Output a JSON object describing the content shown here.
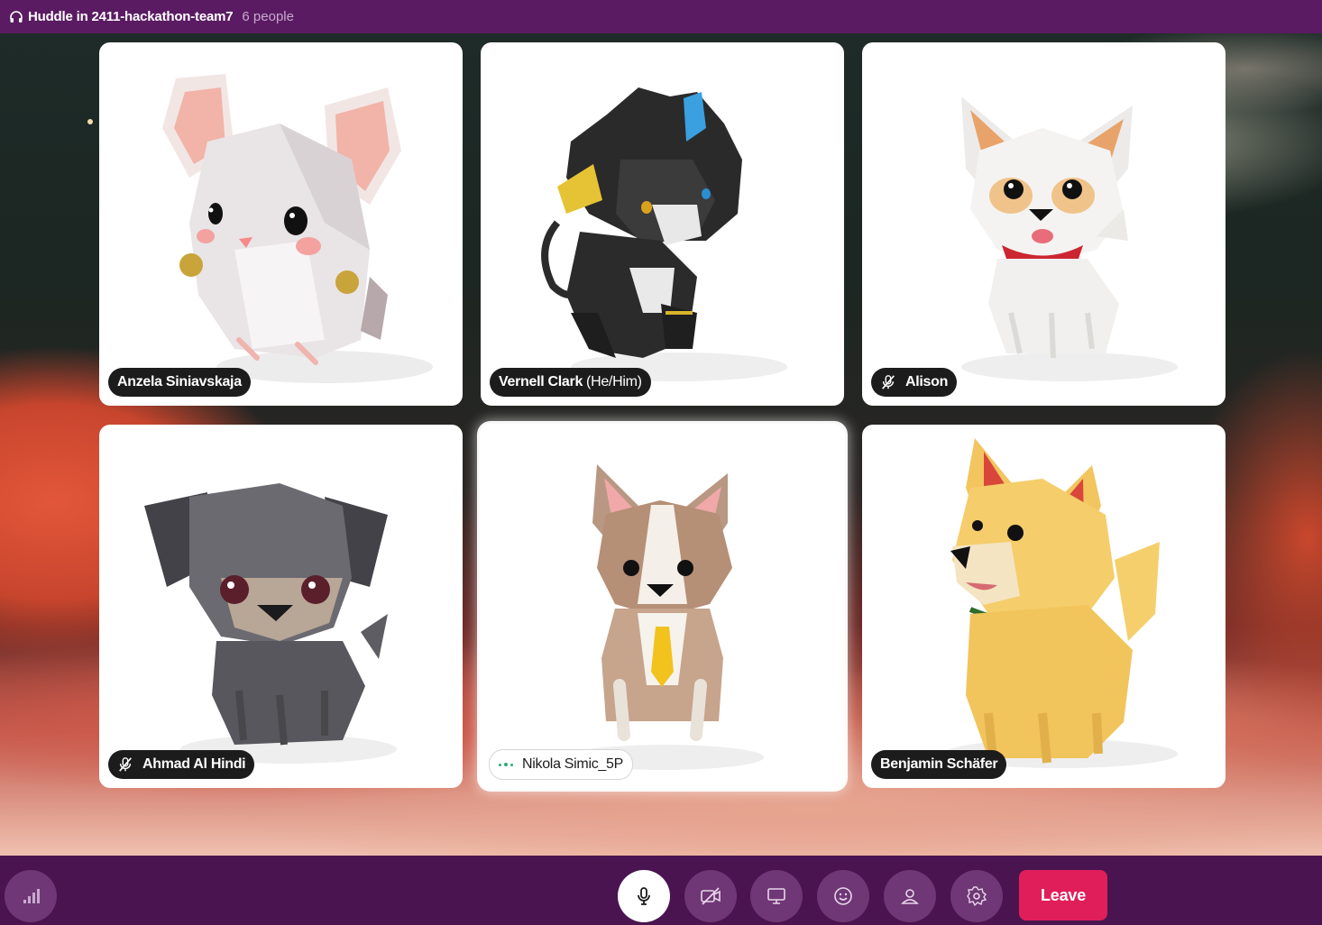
{
  "huddle": {
    "title": "Huddle in 2411-hackathon-team7",
    "people": "6 people"
  },
  "participants": [
    {
      "name": "Anzela Siniavskaja",
      "pronouns": "",
      "muted": false,
      "speaking": false,
      "avatar": "mouse"
    },
    {
      "name": "Vernell Clark",
      "pronouns": "(He/Him)",
      "muted": false,
      "speaking": false,
      "avatar": "black-lion"
    },
    {
      "name": "Alison",
      "pronouns": "",
      "muted": true,
      "speaking": false,
      "avatar": "white-dog"
    },
    {
      "name": "Ahmad Al Hindi",
      "pronouns": "",
      "muted": true,
      "speaking": false,
      "avatar": "grey-puppy"
    },
    {
      "name": "Nikola Simic_5P",
      "pronouns": "",
      "muted": false,
      "speaking": true,
      "avatar": "corgi-with-tie"
    },
    {
      "name": "Benjamin Schäfer",
      "pronouns": "",
      "muted": false,
      "speaking": false,
      "avatar": "shiba"
    }
  ],
  "controls": {
    "leave_label": "Leave",
    "icons": [
      "connection-bars-icon",
      "microphone-icon",
      "video-off-icon",
      "screen-share-icon",
      "emoji-icon",
      "people-icon",
      "settings-icon"
    ]
  },
  "colors": {
    "topbar": "#5a1b62",
    "bottombar": "#4a1450",
    "leave": "#e01e5a",
    "speaking": "#2bac76"
  }
}
